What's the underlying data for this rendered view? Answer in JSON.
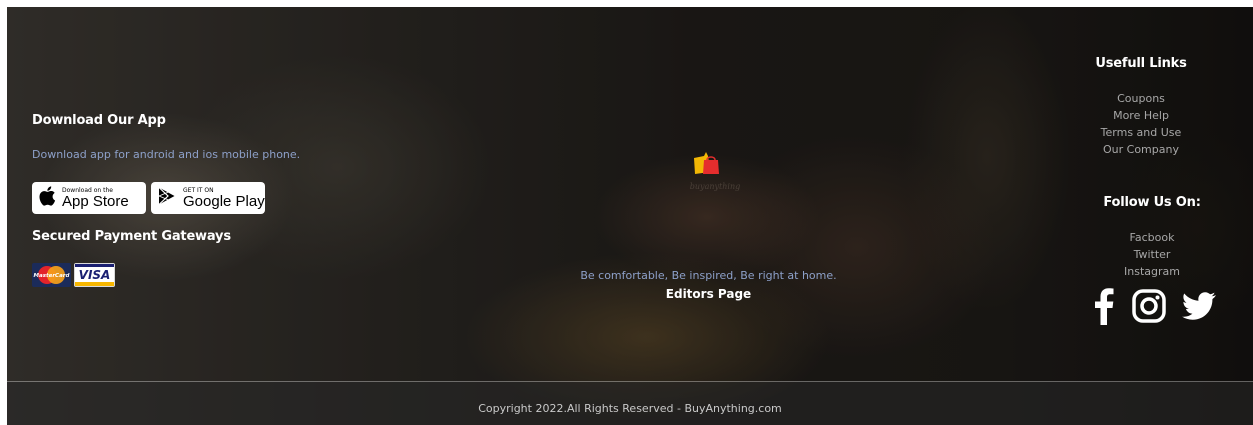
{
  "download_app": {
    "title": "Download Our App",
    "description": "Download app for android and ios mobile phone.",
    "app_store": {
      "small": "Download on the",
      "large": "App Store",
      "icon": "apple-icon"
    },
    "google_play": {
      "small": "GET IT ON",
      "large": "Google Play",
      "icon": "play-icon"
    }
  },
  "payments": {
    "title": "Secured Payment Gateways",
    "mastercard_label": "MasterCard",
    "visa_label": "VISA"
  },
  "center": {
    "tagline": "Be comfortable, Be inspired, Be right at home.",
    "editors_link": "Editors Page"
  },
  "useful_links": {
    "title": "Usefull Links",
    "items": [
      "Coupons",
      "More Help",
      "Terms and Use",
      "Our Company"
    ]
  },
  "follow": {
    "title": "Follow Us On:",
    "items": [
      "Facbook",
      "Twitter",
      "Instagram"
    ],
    "icons": [
      "facebook-icon",
      "instagram-icon",
      "twitter-icon"
    ]
  },
  "footer": {
    "copyright": "Copyright 2022.All Rights Reserved - BuyAnything.com"
  },
  "colors": {
    "muted_blue": "#8da0c9",
    "logo_yellow": "#f2b705",
    "logo_red": "#e52d2d",
    "visa_blue": "#1a1f71"
  }
}
